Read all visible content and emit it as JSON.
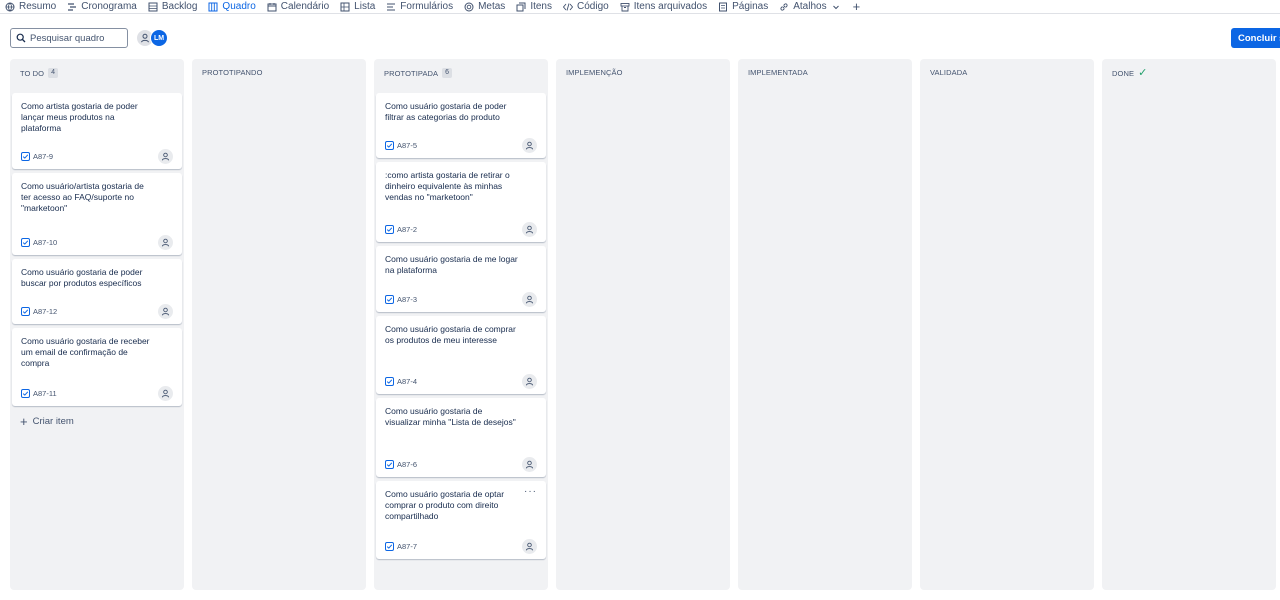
{
  "nav": {
    "tabs": [
      {
        "label": "Resumo",
        "icon": "globe-icon"
      },
      {
        "label": "Cronograma",
        "icon": "timeline-icon"
      },
      {
        "label": "Backlog",
        "icon": "backlog-icon"
      },
      {
        "label": "Quadro",
        "icon": "board-icon",
        "active": true
      },
      {
        "label": "Calendário",
        "icon": "calendar-icon"
      },
      {
        "label": "Lista",
        "icon": "list-icon"
      },
      {
        "label": "Formulários",
        "icon": "form-icon"
      },
      {
        "label": "Metas",
        "icon": "target-icon"
      },
      {
        "label": "Itens",
        "icon": "items-icon"
      },
      {
        "label": "Código",
        "icon": "code-icon"
      },
      {
        "label": "Itens arquivados",
        "icon": "archive-icon"
      },
      {
        "label": "Páginas",
        "icon": "pages-icon"
      },
      {
        "label": "Atalhos",
        "icon": "link-icon",
        "dropdown": true
      }
    ],
    "add_label": "+"
  },
  "toolbar": {
    "search_placeholder": "Pesquisar quadro",
    "user_initials": "LM",
    "complete_sprint_label": "Concluir sprint"
  },
  "colors": {
    "accent": "#0c66e4",
    "column_bg": "#f1f2f4",
    "done_check": "#22a06b"
  },
  "board": {
    "columns": [
      {
        "name": "TO DO",
        "count": "4",
        "cards": [
          {
            "title": "Como artista gostaria de poder lançar meus produtos na plataforma",
            "key": "A87-9"
          },
          {
            "title": "Como usuário/artista gostaria de ter acesso ao FAQ/suporte no \"marketoon\"",
            "key": "A87-10"
          },
          {
            "title": "Como usuário gostaria de poder buscar por produtos específicos",
            "key": "A87-12"
          },
          {
            "title": "Como usuário gostaria de receber um email de confirmação de compra",
            "key": "A87-11"
          }
        ],
        "create_label": "Criar item"
      },
      {
        "name": "PROTOTIPANDO",
        "cards": []
      },
      {
        "name": "PROTOTIPADA",
        "count": "6",
        "cards": [
          {
            "title": "Como usuário gostaria de poder filtrar as categorias do produto",
            "key": "A87-5"
          },
          {
            "title": ":como artista gostaria de retirar o dinheiro equivalente às minhas vendas no \"marketoon\"",
            "key": "A87-2"
          },
          {
            "title": "Como usuário gostaria de me logar na plataforma",
            "key": "A87-3"
          },
          {
            "title": "Como usuário gostaria de comprar os produtos de meu interesse",
            "key": "A87-4"
          },
          {
            "title": "Como usuário gostaria de visualizar minha \"Lista de desejos\"",
            "key": "A87-6"
          },
          {
            "title": "Como usuário gostaria de optar comprar o produto com direito compartilhado",
            "key": "A87-7",
            "more": "···"
          }
        ]
      },
      {
        "name": "IMPLEMENÇÃO",
        "cards": []
      },
      {
        "name": "IMPLEMENTADA",
        "cards": []
      },
      {
        "name": "VALIDADA",
        "cards": []
      },
      {
        "name": "DONE",
        "done": true,
        "check": "✓",
        "cards": []
      }
    ]
  }
}
